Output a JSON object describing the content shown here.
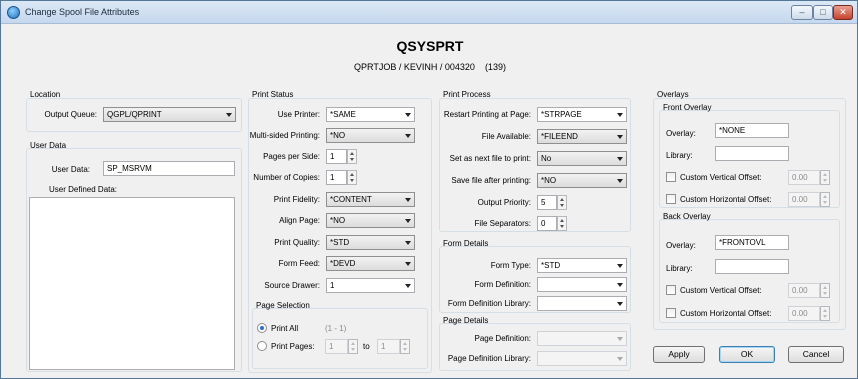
{
  "window": {
    "title": "Change Spool File Attributes",
    "minimize": "–",
    "maximize": "□",
    "close": "✕"
  },
  "header": {
    "name": "QSYSPRT",
    "job": "QPRTJOB / KEVINH / 004320",
    "number": "(139)"
  },
  "location": {
    "title": "Location",
    "output_queue_label": "Output Queue:",
    "output_queue_value": "QGPL/QPRINT"
  },
  "user_data": {
    "title": "User Data",
    "user_data_label": "User Data:",
    "user_data_value": "SP_MSRVM",
    "user_defined_label": "User Defined Data:",
    "user_defined_value": ""
  },
  "print_status": {
    "title": "Print Status",
    "use_printer_label": "Use Printer:",
    "use_printer_value": "*SAME",
    "multi_sided_label": "Multi-sided Printing:",
    "multi_sided_value": "*NO",
    "pages_per_side_label": "Pages per Side:",
    "pages_per_side_value": "1",
    "copies_label": "Number of Copies:",
    "copies_value": "1",
    "fidelity_label": "Print Fidelity:",
    "fidelity_value": "*CONTENT",
    "align_label": "Align Page:",
    "align_value": "*NO",
    "quality_label": "Print Quality:",
    "quality_value": "*STD",
    "form_feed_label": "Form Feed:",
    "form_feed_value": "*DEVD",
    "source_drawer_label": "Source Drawer:",
    "source_drawer_value": "1"
  },
  "page_selection": {
    "title": "Page Selection",
    "print_all_label": "Print All",
    "print_all_range": "(1 - 1)",
    "print_pages_label": "Print Pages:",
    "from_value": "1",
    "to_label": "to",
    "to_value": "1"
  },
  "print_process": {
    "title": "Print Process",
    "restart_label": "Restart Printing at Page:",
    "restart_value": "*STRPAGE",
    "file_available_label": "File Available:",
    "file_available_value": "*FILEEND",
    "next_file_label": "Set as next file to print:",
    "next_file_value": "No",
    "save_label": "Save file after printing:",
    "save_value": "*NO",
    "priority_label": "Output Priority:",
    "priority_value": "5",
    "separators_label": "File Separators:",
    "separators_value": "0"
  },
  "form_details": {
    "title": "Form Details",
    "form_type_label": "Form Type:",
    "form_type_value": "*STD",
    "form_def_label": "Form Definition:",
    "form_def_value": "",
    "form_def_lib_label": "Form Definition Library:",
    "form_def_lib_value": ""
  },
  "page_details": {
    "title": "Page Details",
    "page_def_label": "Page Definition:",
    "page_def_value": "",
    "page_def_lib_label": "Page Definition Library:",
    "page_def_lib_value": ""
  },
  "overlays": {
    "title": "Overlays",
    "front": {
      "title": "Front Overlay",
      "overlay_label": "Overlay:",
      "overlay_value": "*NONE",
      "library_label": "Library:",
      "library_value": "",
      "vertical_label": "Custom Vertical Offset:",
      "vertical_value": "0.00",
      "horizontal_label": "Custom Horizontal Offset:",
      "horizontal_value": "0.00"
    },
    "back": {
      "title": "Back Overlay",
      "overlay_label": "Overlay:",
      "overlay_value": "*FRONTOVL",
      "library_label": "Library:",
      "library_value": "",
      "vertical_label": "Custom Vertical Offset:",
      "vertical_value": "0.00",
      "horizontal_label": "Custom Horizontal Offset:",
      "horizontal_value": "0.00"
    }
  },
  "buttons": {
    "apply": "Apply",
    "ok": "OK",
    "cancel": "Cancel"
  }
}
